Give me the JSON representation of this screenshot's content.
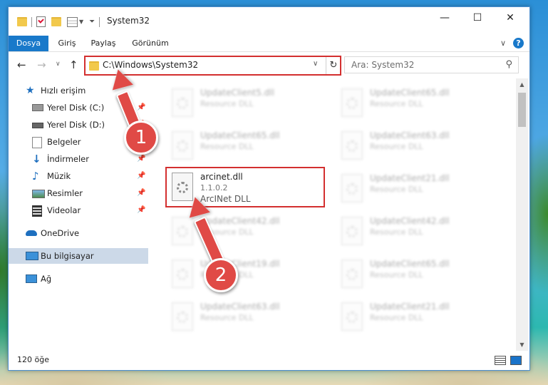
{
  "window": {
    "title": "System32"
  },
  "titlebar": {
    "minimize": "—",
    "maximize": "☐",
    "close": "✕"
  },
  "ribbon": {
    "tabs": [
      {
        "label": "Dosya"
      },
      {
        "label": "Giriş"
      },
      {
        "label": "Paylaş"
      },
      {
        "label": "Görünüm"
      }
    ],
    "collapse_glyph": "∨",
    "help_glyph": "?"
  },
  "address": {
    "path": "C:\\Windows\\System32",
    "search_placeholder": "Ara: System32"
  },
  "navigation": {
    "items": [
      {
        "label": "Hızlı erişim",
        "icon": "star-icon"
      },
      {
        "label": "Yerel Disk (C:)",
        "icon": "drive-icon",
        "pinned": true
      },
      {
        "label": "Yerel Disk (D:)",
        "icon": "drive-icon",
        "pinned": true
      },
      {
        "label": "Belgeler",
        "icon": "documents-icon",
        "pinned": true
      },
      {
        "label": "İndirmeler",
        "icon": "downloads-icon",
        "pinned": true
      },
      {
        "label": "Müzik",
        "icon": "music-icon",
        "pinned": true
      },
      {
        "label": "Resimler",
        "icon": "pictures-icon",
        "pinned": true
      },
      {
        "label": "Videolar",
        "icon": "videos-icon",
        "pinned": true
      },
      {
        "label": "OneDrive",
        "icon": "onedrive-icon"
      },
      {
        "label": "Bu bilgisayar",
        "icon": "computer-icon",
        "selected": true
      },
      {
        "label": "Ağ",
        "icon": "network-icon"
      }
    ]
  },
  "files": {
    "left_column": [
      {
        "name": "UpdateClient5.dll",
        "desc": "Resource DLL"
      },
      {
        "name": "UpdateClient65.dll",
        "desc": "Resource DLL"
      },
      {
        "name": "arcinet.dll",
        "version": "1.1.0.2",
        "desc": "ArcINet DLL"
      },
      {
        "name": "UpdateClient42.dll",
        "desc": "Resource DLL"
      },
      {
        "name": "UpdateClient19.dll",
        "desc": "Resource DLL"
      },
      {
        "name": "UpdateClient63.dll",
        "desc": "Resource DLL"
      }
    ],
    "right_column": [
      {
        "name": "UpdateClient65.dll",
        "desc": "Resource DLL"
      },
      {
        "name": "UpdateClient63.dll",
        "desc": "Resource DLL"
      },
      {
        "name": "UpdateClient21.dll",
        "desc": "Resource DLL"
      },
      {
        "name": "UpdateClient42.dll",
        "desc": "Resource DLL"
      },
      {
        "name": "UpdateClient65.dll",
        "desc": "Resource DLL"
      },
      {
        "name": "UpdateClient21.dll",
        "desc": "Resource DLL"
      }
    ]
  },
  "status": {
    "count": "120 öğe"
  },
  "annotations": {
    "badge_1": "1",
    "badge_2": "2",
    "color": "#e04a46"
  }
}
